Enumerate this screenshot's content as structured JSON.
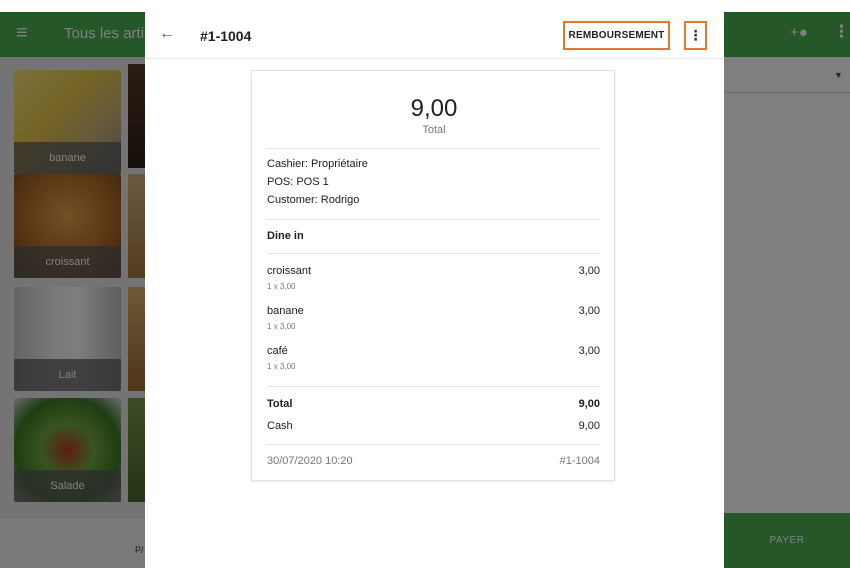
{
  "background": {
    "title": "Tous les arti",
    "tiles": [
      {
        "label": "banane"
      },
      {
        "label": "croissant"
      },
      {
        "label": "Lait"
      },
      {
        "label": "Salade"
      }
    ],
    "bottom_text": "P/",
    "pay_label": "PAYER"
  },
  "dialog": {
    "receipt_id": "#1-1004",
    "refund_label": "REMBOURSEMENT",
    "total_amount": "9,00",
    "total_caption": "Total",
    "cashier": "Cashier: Propriétaire",
    "pos": "POS: POS 1",
    "customer": "Customer: Rodrigo",
    "dining_option": "Dine in",
    "items": [
      {
        "name": "croissant",
        "qty": "1 x 3,00",
        "price": "3,00"
      },
      {
        "name": "banane",
        "qty": "1 x 3,00",
        "price": "3,00"
      },
      {
        "name": "café",
        "qty": "1 x 3,00",
        "price": "3,00"
      }
    ],
    "total_label": "Total",
    "total_value": "9,00",
    "payment_label": "Cash",
    "payment_value": "9,00",
    "datetime": "30/07/2020 10:20",
    "footer_id": "#1-1004"
  },
  "colors": {
    "brand_green": "#4caf50",
    "highlight_orange": "#e8772e"
  }
}
